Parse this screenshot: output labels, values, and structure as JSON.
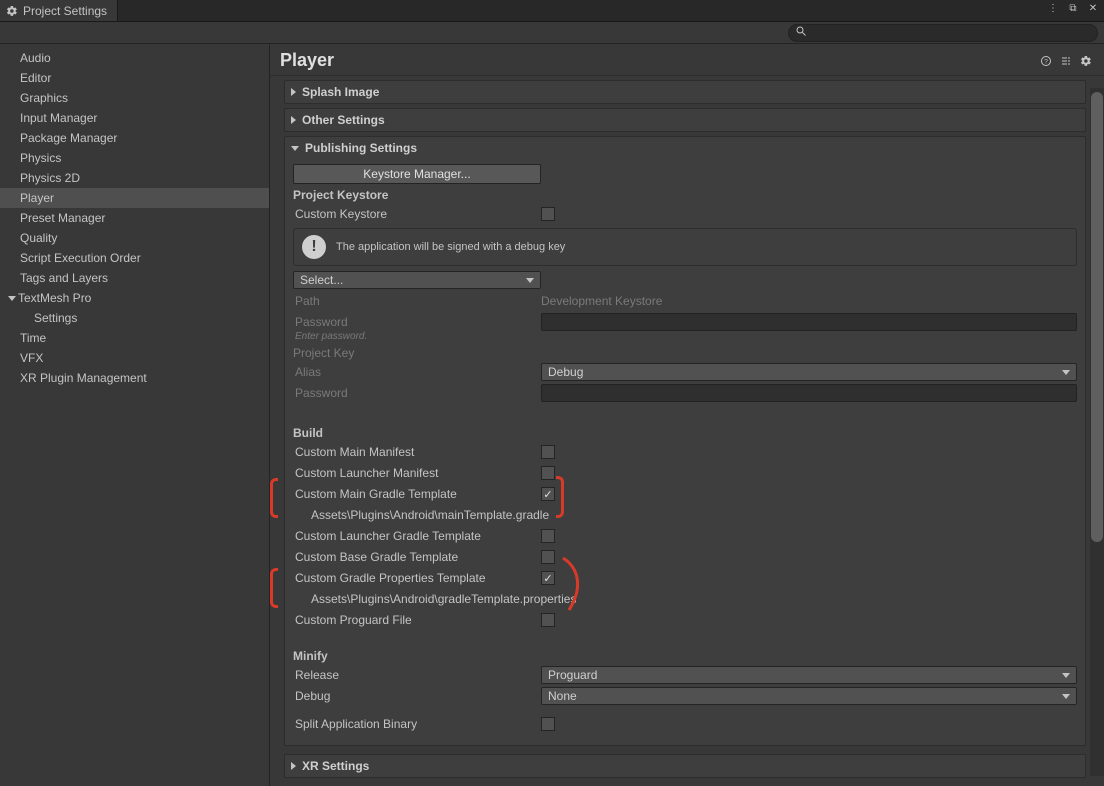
{
  "window": {
    "title": "Project Settings"
  },
  "sidebar": {
    "items": [
      "Audio",
      "Editor",
      "Graphics",
      "Input Manager",
      "Package Manager",
      "Physics",
      "Physics 2D",
      "Player",
      "Preset Manager",
      "Quality",
      "Script Execution Order",
      "Tags and Layers",
      "TextMesh Pro",
      "Settings",
      "Time",
      "VFX",
      "XR Plugin Management"
    ],
    "selectedIndex": 7,
    "foldoutIndex": 12,
    "childIndex": 13
  },
  "main": {
    "title": "Player",
    "foldouts": {
      "splash": "Splash Image",
      "other": "Other Settings",
      "publishing": "Publishing Settings",
      "xr": "XR Settings"
    },
    "publishing": {
      "keystoreBtn": "Keystore Manager...",
      "projectKeystore": "Project Keystore",
      "customKeystore": "Custom Keystore",
      "info": "The application will be signed with a debug key",
      "selectPlaceholder": "Select...",
      "pathLabel": "Path",
      "pathValue": "Development Keystore",
      "passwordLabel": "Password",
      "passwordHint": "Enter password.",
      "projectKey": "Project Key",
      "aliasLabel": "Alias",
      "aliasValue": "Debug",
      "buildTitle": "Build",
      "customMainManifest": "Custom Main Manifest",
      "customLauncherManifest": "Custom Launcher Manifest",
      "customMainGradle": "Custom Main Gradle Template",
      "customMainGradlePath": "Assets\\Plugins\\Android\\mainTemplate.gradle",
      "customLauncherGradle": "Custom Launcher Gradle Template",
      "customBaseGradle": "Custom Base Gradle Template",
      "customGradleProps": "Custom Gradle Properties Template",
      "customGradlePropsPath": "Assets\\Plugins\\Android\\gradleTemplate.properties",
      "customProguard": "Custom Proguard File",
      "minifyTitle": "Minify",
      "releaseLabel": "Release",
      "releaseValue": "Proguard",
      "debugLabel": "Debug",
      "debugValue": "None",
      "splitBinary": "Split Application Binary"
    }
  }
}
